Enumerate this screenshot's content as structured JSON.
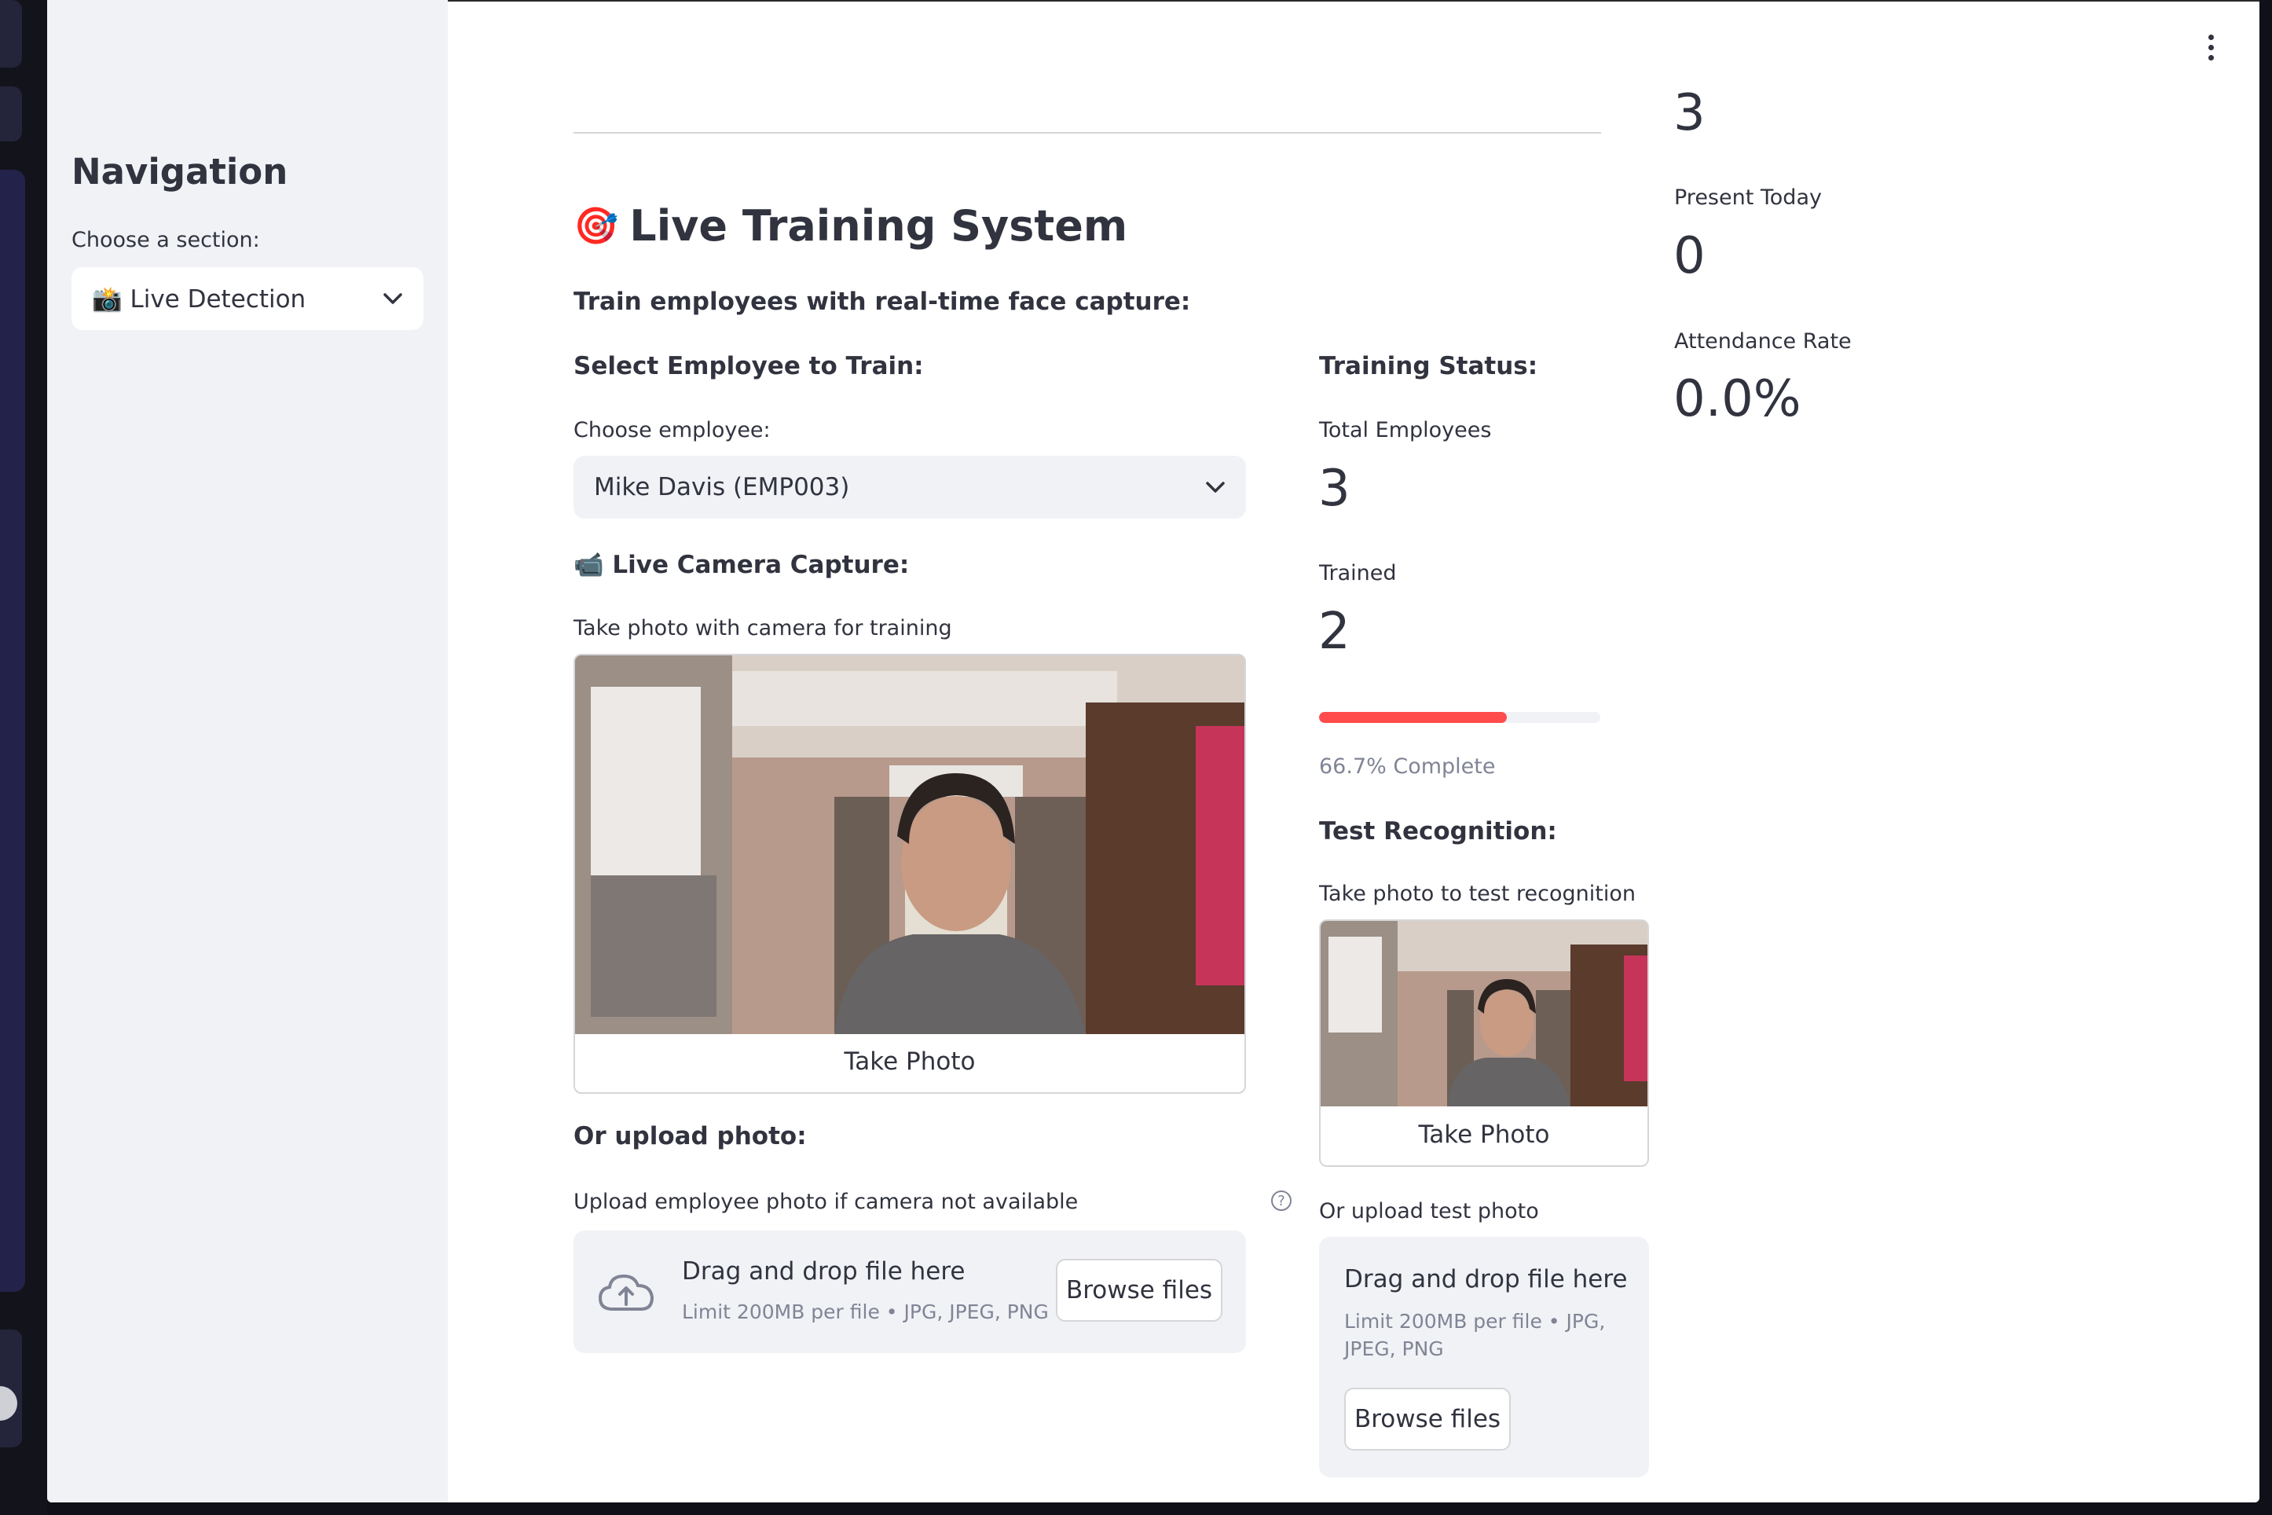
{
  "sidebar": {
    "title": "Navigation",
    "select_label": "Choose a section:",
    "select_value": "📸 Live Detection"
  },
  "metrics": {
    "top_value": "3",
    "present_today_label": "Present Today",
    "present_today_value": "0",
    "attendance_rate_label": "Attendance Rate",
    "attendance_rate_value": "0.0%"
  },
  "training": {
    "emoji": "🎯",
    "title": "Live Training System",
    "subtitle": "Train employees with real-time face capture:",
    "select_header": "Select Employee to Train:",
    "choose_label": "Choose employee:",
    "employee_value": "Mike Davis (EMP003)",
    "camera_header": "📹 Live Camera Capture:",
    "camera_label": "Take photo with camera for training",
    "take_photo": "Take Photo",
    "upload_header": "Or upload photo:",
    "upload_label": "Upload employee photo if camera not available",
    "drag_text": "Drag and drop file here",
    "limit_text": "Limit 200MB per file • JPG, JPEG, PNG",
    "browse": "Browse files"
  },
  "status": {
    "header": "Training Status:",
    "total_label": "Total Employees",
    "total_value": "3",
    "trained_label": "Trained",
    "trained_value": "2",
    "progress_fraction": 0.667,
    "progress_text": "66.7% Complete",
    "accent_color": "#ff4b4b"
  },
  "test": {
    "header": "Test Recognition:",
    "camera_label": "Take photo to test recognition",
    "take_photo": "Take Photo",
    "upload_label": "Or upload test photo",
    "drag_text": "Drag and drop file here",
    "limit_line1": "Limit 200MB per file • JPG,",
    "limit_line2": "JPEG, PNG",
    "browse": "Browse files"
  }
}
